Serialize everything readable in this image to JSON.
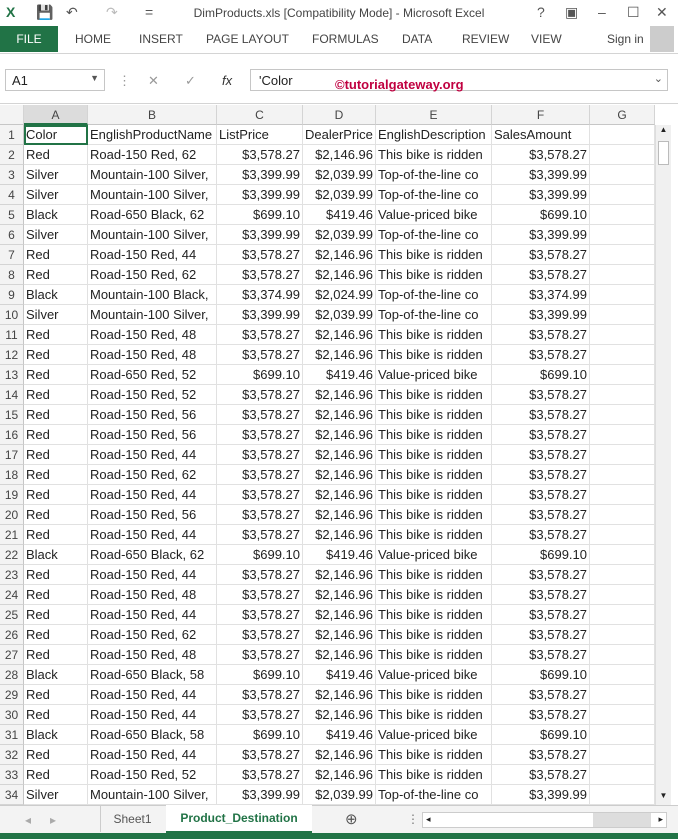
{
  "window": {
    "title": "DimProducts.xls  [Compatibility Mode] - Microsoft Excel",
    "help": "?",
    "minimize": "–",
    "maximize": "☐",
    "close": "✕"
  },
  "ribbon": {
    "file": "FILE",
    "tabs": [
      "HOME",
      "INSERT",
      "PAGE LAYOUT",
      "FORMULAS",
      "DATA",
      "REVIEW",
      "VIEW"
    ],
    "sign_in": "Sign in"
  },
  "formula_bar": {
    "name_box": "A1",
    "value": "'Color",
    "fx": "fx",
    "watermark": "©tutorialgateway.org"
  },
  "columns": [
    "A",
    "B",
    "C",
    "D",
    "E",
    "F",
    "G"
  ],
  "rows": [
    [
      "Color",
      "EnglishProductName",
      "ListPrice",
      "DealerPrice",
      "EnglishDescription",
      "SalesAmount"
    ],
    [
      "Red",
      "Road-150 Red, 62",
      "$3,578.27",
      "$2,146.96",
      "This bike is ridden",
      "$3,578.27"
    ],
    [
      "Silver",
      "Mountain-100 Silver,",
      "$3,399.99",
      "$2,039.99",
      "Top-of-the-line co",
      "$3,399.99"
    ],
    [
      "Silver",
      "Mountain-100 Silver,",
      "$3,399.99",
      "$2,039.99",
      "Top-of-the-line co",
      "$3,399.99"
    ],
    [
      "Black",
      "Road-650 Black, 62",
      "$699.10",
      "$419.46",
      "Value-priced bike",
      "$699.10"
    ],
    [
      "Silver",
      "Mountain-100 Silver,",
      "$3,399.99",
      "$2,039.99",
      "Top-of-the-line co",
      "$3,399.99"
    ],
    [
      "Red",
      "Road-150 Red, 44",
      "$3,578.27",
      "$2,146.96",
      "This bike is ridden",
      "$3,578.27"
    ],
    [
      "Red",
      "Road-150 Red, 62",
      "$3,578.27",
      "$2,146.96",
      "This bike is ridden",
      "$3,578.27"
    ],
    [
      "Black",
      "Mountain-100 Black,",
      "$3,374.99",
      "$2,024.99",
      "Top-of-the-line co",
      "$3,374.99"
    ],
    [
      "Silver",
      "Mountain-100 Silver,",
      "$3,399.99",
      "$2,039.99",
      "Top-of-the-line co",
      "$3,399.99"
    ],
    [
      "Red",
      "Road-150 Red, 48",
      "$3,578.27",
      "$2,146.96",
      "This bike is ridden",
      "$3,578.27"
    ],
    [
      "Red",
      "Road-150 Red, 48",
      "$3,578.27",
      "$2,146.96",
      "This bike is ridden",
      "$3,578.27"
    ],
    [
      "Red",
      "Road-650 Red, 52",
      "$699.10",
      "$419.46",
      "Value-priced bike",
      "$699.10"
    ],
    [
      "Red",
      "Road-150 Red, 52",
      "$3,578.27",
      "$2,146.96",
      "This bike is ridden",
      "$3,578.27"
    ],
    [
      "Red",
      "Road-150 Red, 56",
      "$3,578.27",
      "$2,146.96",
      "This bike is ridden",
      "$3,578.27"
    ],
    [
      "Red",
      "Road-150 Red, 56",
      "$3,578.27",
      "$2,146.96",
      "This bike is ridden",
      "$3,578.27"
    ],
    [
      "Red",
      "Road-150 Red, 44",
      "$3,578.27",
      "$2,146.96",
      "This bike is ridden",
      "$3,578.27"
    ],
    [
      "Red",
      "Road-150 Red, 62",
      "$3,578.27",
      "$2,146.96",
      "This bike is ridden",
      "$3,578.27"
    ],
    [
      "Red",
      "Road-150 Red, 44",
      "$3,578.27",
      "$2,146.96",
      "This bike is ridden",
      "$3,578.27"
    ],
    [
      "Red",
      "Road-150 Red, 56",
      "$3,578.27",
      "$2,146.96",
      "This bike is ridden",
      "$3,578.27"
    ],
    [
      "Red",
      "Road-150 Red, 44",
      "$3,578.27",
      "$2,146.96",
      "This bike is ridden",
      "$3,578.27"
    ],
    [
      "Black",
      "Road-650 Black, 62",
      "$699.10",
      "$419.46",
      "Value-priced bike",
      "$699.10"
    ],
    [
      "Red",
      "Road-150 Red, 44",
      "$3,578.27",
      "$2,146.96",
      "This bike is ridden",
      "$3,578.27"
    ],
    [
      "Red",
      "Road-150 Red, 48",
      "$3,578.27",
      "$2,146.96",
      "This bike is ridden",
      "$3,578.27"
    ],
    [
      "Red",
      "Road-150 Red, 44",
      "$3,578.27",
      "$2,146.96",
      "This bike is ridden",
      "$3,578.27"
    ],
    [
      "Red",
      "Road-150 Red, 62",
      "$3,578.27",
      "$2,146.96",
      "This bike is ridden",
      "$3,578.27"
    ],
    [
      "Red",
      "Road-150 Red, 48",
      "$3,578.27",
      "$2,146.96",
      "This bike is ridden",
      "$3,578.27"
    ],
    [
      "Black",
      "Road-650 Black, 58",
      "$699.10",
      "$419.46",
      "Value-priced bike",
      "$699.10"
    ],
    [
      "Red",
      "Road-150 Red, 44",
      "$3,578.27",
      "$2,146.96",
      "This bike is ridden",
      "$3,578.27"
    ],
    [
      "Red",
      "Road-150 Red, 44",
      "$3,578.27",
      "$2,146.96",
      "This bike is ridden",
      "$3,578.27"
    ],
    [
      "Black",
      "Road-650 Black, 58",
      "$699.10",
      "$419.46",
      "Value-priced bike",
      "$699.10"
    ],
    [
      "Red",
      "Road-150 Red, 44",
      "$3,578.27",
      "$2,146.96",
      "This bike is ridden",
      "$3,578.27"
    ],
    [
      "Red",
      "Road-150 Red, 52",
      "$3,578.27",
      "$2,146.96",
      "This bike is ridden",
      "$3,578.27"
    ],
    [
      "Silver",
      "Mountain-100 Silver,",
      "$3,399.99",
      "$2,039.99",
      "Top-of-the-line co",
      "$3,399.99"
    ]
  ],
  "sheets": [
    "Sheet1",
    "Product_Destination"
  ],
  "active_sheet": "Product_Destination",
  "colors": {
    "accent": "#217346"
  }
}
